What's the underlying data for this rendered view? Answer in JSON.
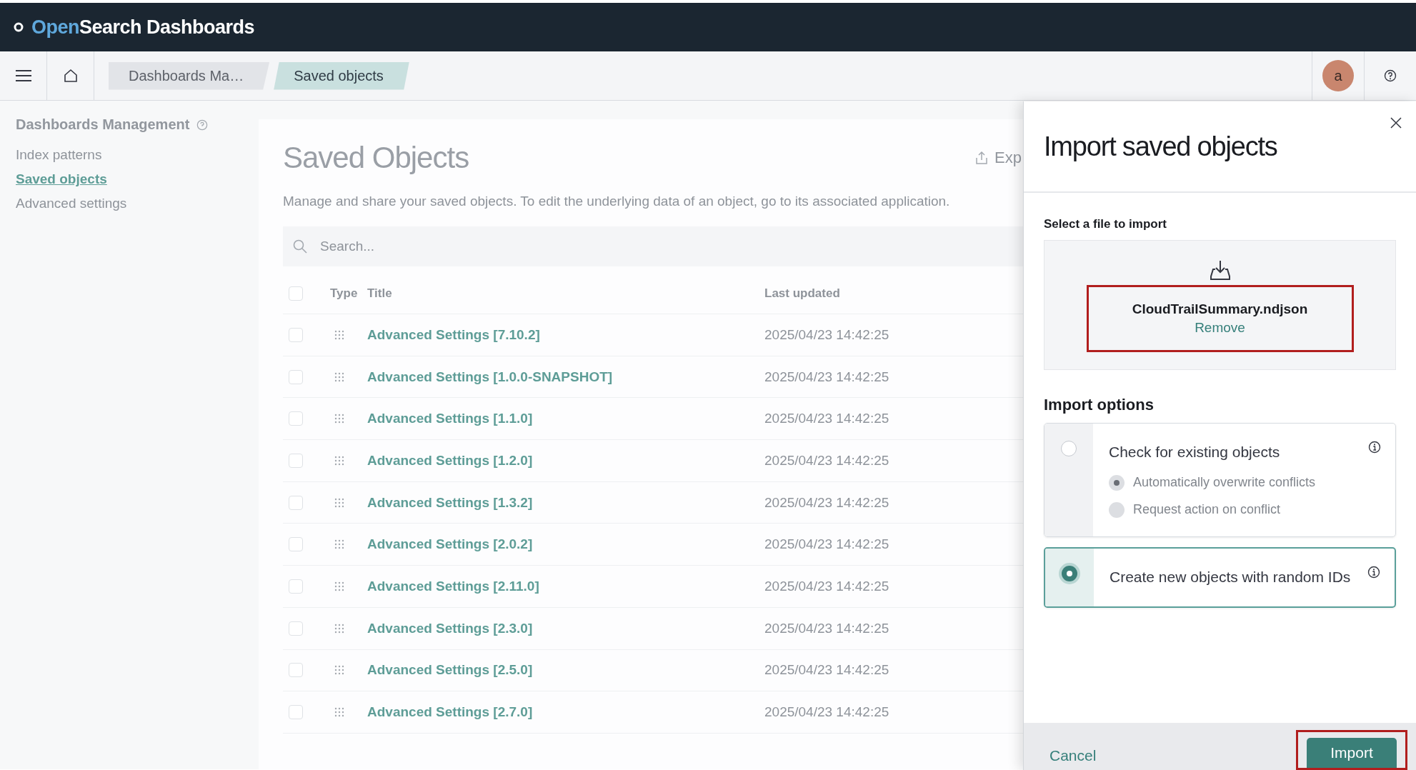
{
  "header": {
    "logo": {
      "accent": "Open",
      "rest": "Search Dashboards"
    }
  },
  "nav_bar": {
    "breadcrumbs": [
      {
        "label": "Dashboards Ma…",
        "selected": false
      },
      {
        "label": "Saved objects",
        "selected": true
      }
    ],
    "avatar": "a"
  },
  "sidebar": {
    "title": "Dashboards Management",
    "items": [
      {
        "label": "Index patterns",
        "selected": false
      },
      {
        "label": "Saved objects",
        "selected": true
      },
      {
        "label": "Advanced settings",
        "selected": false
      }
    ]
  },
  "main": {
    "title": "Saved Objects",
    "export_button": "Exp",
    "description": "Manage and share your saved objects. To edit the underlying data of an object, go to its associated application.",
    "search": {
      "placeholder": "Search..."
    },
    "table": {
      "columns": [
        "Type",
        "Title",
        "Last updated"
      ],
      "header_checked": false,
      "rows": [
        {
          "title": "Advanced Settings [7.10.2]",
          "last_updated": "2025/04/23 14:42:25",
          "checked": false
        },
        {
          "title": "Advanced Settings [1.0.0-SNAPSHOT]",
          "last_updated": "2025/04/23 14:42:25",
          "checked": false
        },
        {
          "title": "Advanced Settings [1.1.0]",
          "last_updated": "2025/04/23 14:42:25",
          "checked": false
        },
        {
          "title": "Advanced Settings [1.2.0]",
          "last_updated": "2025/04/23 14:42:25",
          "checked": false
        },
        {
          "title": "Advanced Settings [1.3.2]",
          "last_updated": "2025/04/23 14:42:25",
          "checked": false
        },
        {
          "title": "Advanced Settings [2.0.2]",
          "last_updated": "2025/04/23 14:42:25",
          "checked": false
        },
        {
          "title": "Advanced Settings [2.11.0]",
          "last_updated": "2025/04/23 14:42:25",
          "checked": false
        },
        {
          "title": "Advanced Settings [2.3.0]",
          "last_updated": "2025/04/23 14:42:25",
          "checked": false
        },
        {
          "title": "Advanced Settings [2.5.0]",
          "last_updated": "2025/04/23 14:42:25",
          "checked": false
        },
        {
          "title": "Advanced Settings [2.7.0]",
          "last_updated": "2025/04/23 14:42:25",
          "checked": false
        }
      ]
    }
  },
  "flyout": {
    "title": "Import saved objects",
    "file_label": "Select a file to import",
    "file_name": "CloudTrailSummary.ndjson",
    "remove_link": "Remove",
    "options_title": "Import options",
    "options": [
      {
        "label": "Check for existing objects",
        "selected": false,
        "suboptions": [
          {
            "label": "Automatically overwrite conflicts",
            "selected": true,
            "disabled": true
          },
          {
            "label": "Request action on conflict",
            "selected": false,
            "disabled": true
          }
        ]
      },
      {
        "label": "Create new objects with random IDs",
        "selected": true
      }
    ],
    "cancel": "Cancel",
    "import": "Import"
  }
}
